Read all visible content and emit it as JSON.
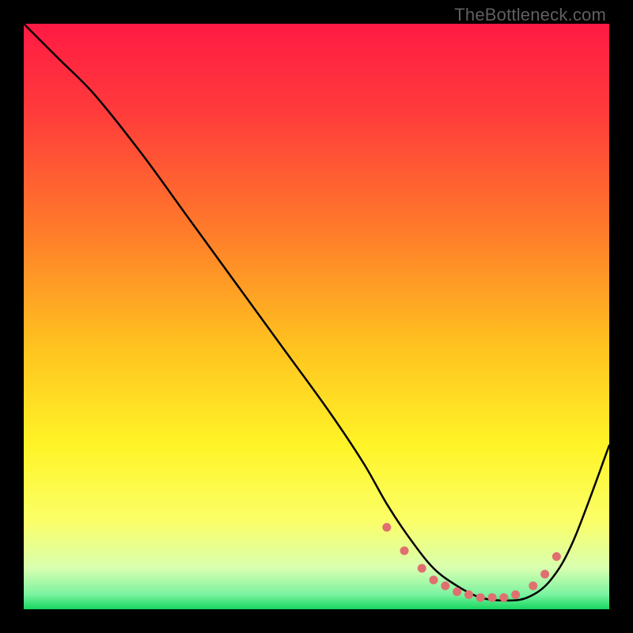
{
  "watermark": "TheBottleneck.com",
  "chart_data": {
    "type": "line",
    "title": "",
    "xlabel": "",
    "ylabel": "",
    "xlim": [
      0,
      100
    ],
    "ylim": [
      0,
      100
    ],
    "grid": false,
    "series": [
      {
        "name": "curve",
        "color": "#000000",
        "x": [
          0,
          6,
          12,
          20,
          28,
          36,
          44,
          52,
          58,
          62,
          66,
          70,
          74,
          78,
          82,
          86,
          90,
          94,
          100
        ],
        "y": [
          100,
          94,
          88,
          78,
          67,
          56,
          45,
          34,
          25,
          18,
          12,
          7,
          4,
          2,
          1.5,
          2,
          5,
          12,
          28
        ]
      }
    ],
    "markers": {
      "name": "dots",
      "color": "#e07070",
      "x": [
        62,
        65,
        68,
        70,
        72,
        74,
        76,
        78,
        80,
        82,
        84,
        87,
        89,
        91
      ],
      "y": [
        14,
        10,
        7,
        5,
        4,
        3,
        2.5,
        2,
        2,
        2,
        2.5,
        4,
        6,
        9
      ]
    },
    "gradient_stops": [
      {
        "offset": 0.0,
        "color": "#ff1a44"
      },
      {
        "offset": 0.15,
        "color": "#ff3b3b"
      },
      {
        "offset": 0.35,
        "color": "#ff7a2a"
      },
      {
        "offset": 0.55,
        "color": "#ffc21f"
      },
      {
        "offset": 0.72,
        "color": "#fff427"
      },
      {
        "offset": 0.85,
        "color": "#fbff68"
      },
      {
        "offset": 0.93,
        "color": "#d8ffb0"
      },
      {
        "offset": 0.975,
        "color": "#7af3a0"
      },
      {
        "offset": 1.0,
        "color": "#16d65e"
      }
    ]
  }
}
